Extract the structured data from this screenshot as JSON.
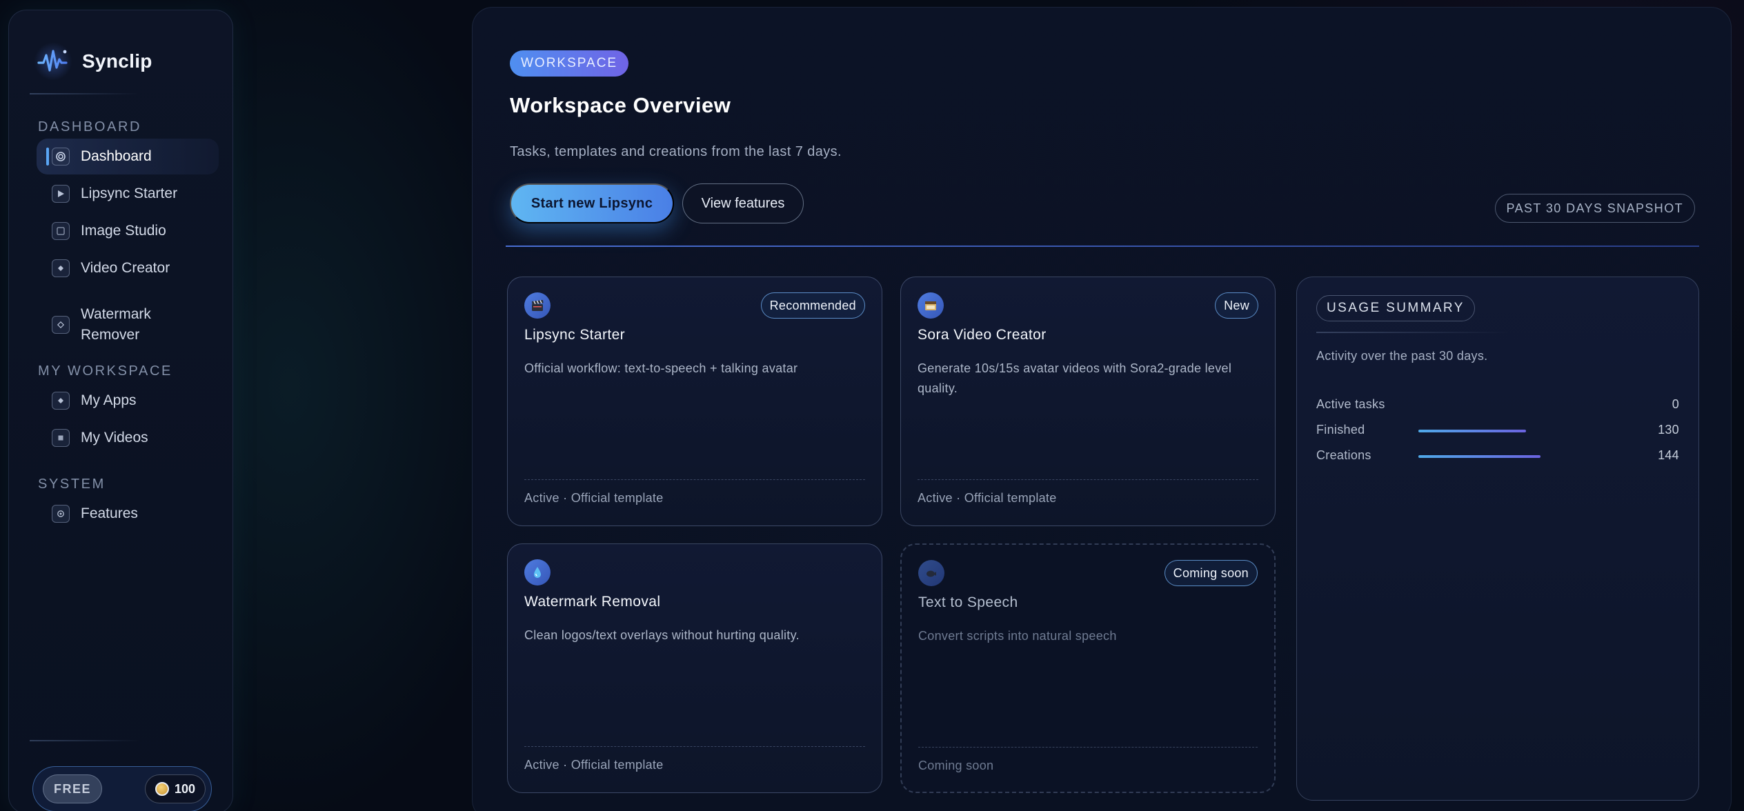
{
  "brand": {
    "name": "Synclip"
  },
  "sidebar": {
    "sections": [
      {
        "title": "DASHBOARD",
        "items": [
          {
            "label": "Dashboard",
            "icon": "dashboard-icon",
            "active": true
          },
          {
            "label": "Lipsync Starter",
            "icon": "play-icon"
          },
          {
            "label": "Image Studio",
            "icon": "image-icon"
          },
          {
            "label": "Video Creator",
            "icon": "diamond-icon"
          },
          {
            "label": "Watermark Remover",
            "icon": "diamond-outline-icon"
          }
        ]
      },
      {
        "title": "MY WORKSPACE",
        "items": [
          {
            "label": "My Apps",
            "icon": "diamond-icon"
          },
          {
            "label": "My Videos",
            "icon": "square-icon"
          }
        ]
      },
      {
        "title": "SYSTEM",
        "items": [
          {
            "label": "Features",
            "icon": "gear-icon"
          }
        ]
      }
    ],
    "plan": {
      "label": "FREE",
      "credits": "100"
    }
  },
  "header": {
    "eyebrow": "WORKSPACE",
    "title": "Workspace Overview",
    "subtitle": "Tasks, templates and creations from the last 7 days.",
    "primary_button": "Start new Lipsync",
    "secondary_button": "View features",
    "snapshot": "PAST 30 DAYS SNAPSHOT"
  },
  "cards": [
    {
      "title": "Lipsync Starter",
      "badge": "Recommended",
      "icon": "clapperboard-icon",
      "description": "Official workflow: text-to-speech + talking avatar",
      "footer": "Active · Official template"
    },
    {
      "title": "Sora Video Creator",
      "badge": "New",
      "icon": "film-icon",
      "description": "Generate 10s/15s avatar videos with Sora2-grade level quality.",
      "footer": "Active · Official template"
    },
    {
      "title": "Watermark Removal",
      "badge": "",
      "icon": "droplet-icon",
      "description": "Clean logos/text overlays without hurting quality.",
      "footer": "Active · Official template"
    },
    {
      "title": "Text to Speech",
      "badge": "Coming soon",
      "icon": "speech-icon",
      "description": "Convert scripts into natural speech",
      "footer": "Coming soon"
    }
  ],
  "usage": {
    "title": "USAGE SUMMARY",
    "subtitle": "Activity over the past 30 days.",
    "stats": [
      {
        "label": "Active tasks",
        "value": "0",
        "fraction": 0
      },
      {
        "label": "Finished",
        "value": "130",
        "fraction": 0.6
      },
      {
        "label": "Creations",
        "value": "144",
        "fraction": 0.68
      }
    ]
  },
  "colors": {
    "accent_blue": "#5fb6f2",
    "accent_purple": "#6b63e0",
    "background": "#060b16"
  }
}
